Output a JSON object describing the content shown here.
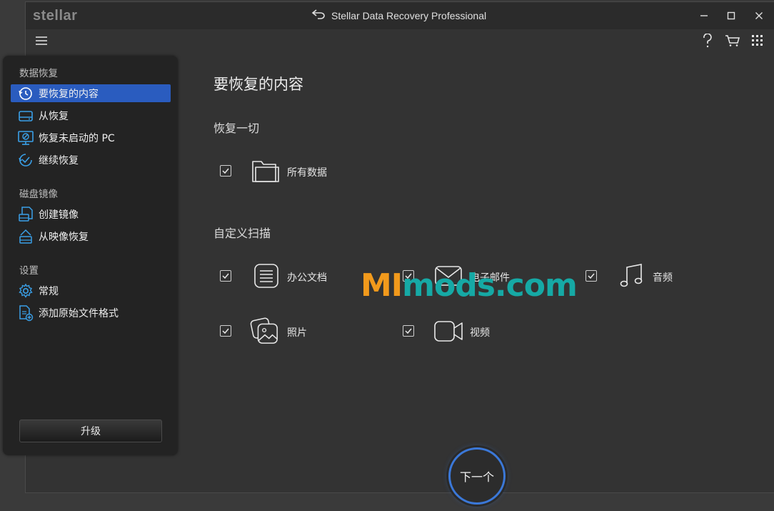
{
  "app": {
    "logo": "stellar",
    "title": "Stellar Data Recovery Professional"
  },
  "sidebar": {
    "sections": [
      {
        "label": "数据恢复"
      },
      {
        "label": "磁盘镜像"
      },
      {
        "label": "设置"
      }
    ],
    "items": [
      {
        "label": "要恢复的内容",
        "icon": "restore-icon"
      },
      {
        "label": "从恢复",
        "icon": "drive-icon"
      },
      {
        "label": "恢复未启动的 PC",
        "icon": "monitor-icon"
      },
      {
        "label": "继续恢复",
        "icon": "resume-icon"
      },
      {
        "label": "创建镜像",
        "icon": "create-image-icon"
      },
      {
        "label": "从映像恢复",
        "icon": "image-restore-icon"
      },
      {
        "label": "常规",
        "icon": "gear-icon"
      },
      {
        "label": "添加原始文件格式",
        "icon": "add-file-icon"
      }
    ],
    "upgrade_label": "升级"
  },
  "main": {
    "title": "要恢复的内容",
    "recover_all_heading": "恢复一切",
    "all_data_label": "所有数据",
    "custom_heading": "自定义扫描",
    "options": [
      {
        "label": "办公文档",
        "checked": true
      },
      {
        "label": "电子邮件",
        "checked": true
      },
      {
        "label": "音频",
        "checked": true
      },
      {
        "label": "照片",
        "checked": true
      },
      {
        "label": "视频",
        "checked": true
      }
    ]
  },
  "watermark": {
    "part1": "MI",
    "part2": "mods.com"
  },
  "next_label": "下一个",
  "colors": {
    "accent": "#2a5cbf",
    "next_ring": "#3b78d8",
    "watermark_orange": "#f29a1c",
    "watermark_teal": "#16a9a5"
  }
}
